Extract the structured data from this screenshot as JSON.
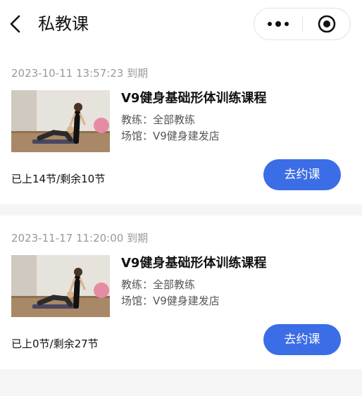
{
  "header": {
    "title": "私教课",
    "back_icon": "chevron-left-icon",
    "more_icon": "more-dots-icon",
    "close_icon": "target-circle-icon"
  },
  "colors": {
    "accent": "#3b6de6",
    "page_background": "#f5f5f5",
    "card_background": "#ffffff",
    "muted_text": "#999999"
  },
  "courses": [
    {
      "expiry": "2023-10-11 13:57:23 到期",
      "title": "V9健身基础形体训练课程",
      "coach": "教练：全部教练",
      "venue": "场馆：V9健身建发店",
      "sessions": "已上14节/剩余10节",
      "book_label": "去约课"
    },
    {
      "expiry": "2023-11-17 11:20:00 到期",
      "title": "V9健身基础形体训练课程",
      "coach": "教练：全部教练",
      "venue": "场馆：V9健身建发店",
      "sessions": "已上0节/剩余27节",
      "book_label": "去约课"
    }
  ]
}
